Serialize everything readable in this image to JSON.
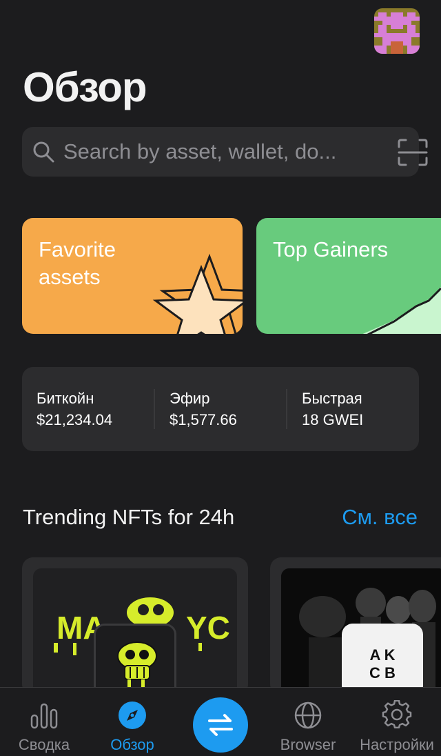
{
  "header": {
    "title": "Обзор",
    "avatar_icon": "pixel-avatar-icon"
  },
  "search": {
    "placeholder": "Search by asset, wallet, do...",
    "value": "",
    "icon": "search-icon",
    "scan_icon": "scan-icon"
  },
  "cards": [
    {
      "label": "Favorite assets",
      "color": "#f6a94a",
      "icon": "star-icon"
    },
    {
      "label": "Top Gainers",
      "color": "#68cb7d",
      "icon": "chart-up-icon"
    }
  ],
  "prices": [
    {
      "label": "Биткойн",
      "value": "$21,234.04"
    },
    {
      "label": "Эфир",
      "value": "$1,577.66"
    },
    {
      "label": "Быстрая",
      "value": "18 GWEI"
    }
  ],
  "trending": {
    "title": "Trending NFTs for 24h",
    "see_all": "См. все",
    "collections": [
      {
        "banner_text_left": "MA",
        "banner_text_right": "YC",
        "logo": "skull-icon"
      },
      {
        "logo_text_top": "A K",
        "logo_text_bottom": "C B"
      }
    ]
  },
  "tabbar": {
    "items": [
      {
        "label": "Сводка",
        "icon": "bar-chart-icon",
        "active": false
      },
      {
        "label": "Обзор",
        "icon": "compass-icon",
        "active": true
      },
      {
        "label": "",
        "icon": "swap-arrows-icon",
        "active": false
      },
      {
        "label": "Browser",
        "icon": "globe-icon",
        "active": false
      },
      {
        "label": "Настройки",
        "icon": "gear-icon",
        "active": false
      }
    ]
  },
  "colors": {
    "background": "#1c1c1e",
    "surface": "#2c2c2e",
    "accent": "#1d9bf0",
    "favorite_card": "#f6a94a",
    "gainers_card": "#68cb7d",
    "nft_yellow": "#d6ec2b"
  }
}
